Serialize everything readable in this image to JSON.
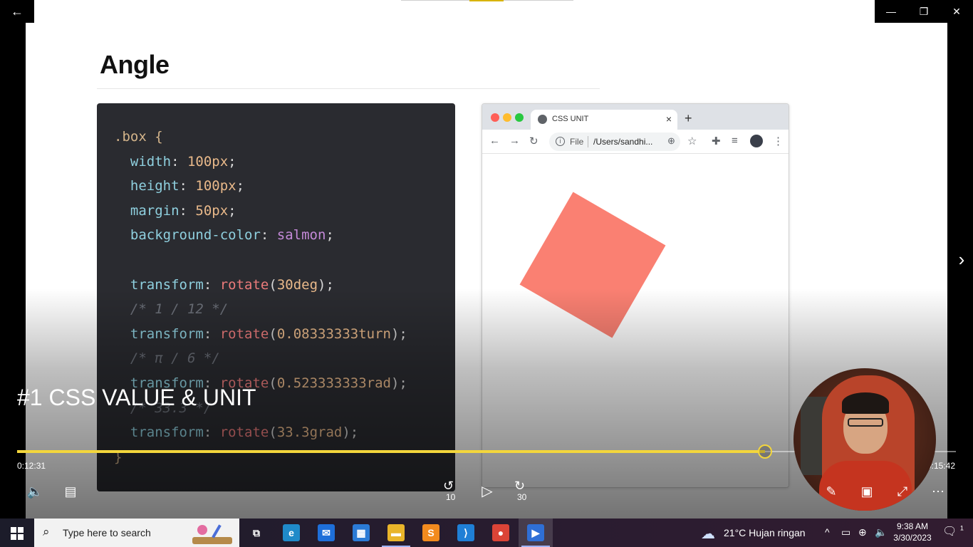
{
  "window": {
    "back_icon": "←",
    "minimize_icon": "—",
    "restore_icon": "❐",
    "close_icon": "✕",
    "next_slide_icon": "›"
  },
  "slide": {
    "title": "Angle",
    "code_lines": [
      [
        {
          "t": ".box {",
          "c": "sel"
        }
      ],
      [
        {
          "t": "  width",
          "c": "prop"
        },
        {
          "t": ": ",
          "c": "pun"
        },
        {
          "t": "100px",
          "c": "num"
        },
        {
          "t": ";",
          "c": "pun"
        }
      ],
      [
        {
          "t": "  height",
          "c": "prop"
        },
        {
          "t": ": ",
          "c": "pun"
        },
        {
          "t": "100px",
          "c": "num"
        },
        {
          "t": ";",
          "c": "pun"
        }
      ],
      [
        {
          "t": "  margin",
          "c": "prop"
        },
        {
          "t": ": ",
          "c": "pun"
        },
        {
          "t": "50px",
          "c": "num"
        },
        {
          "t": ";",
          "c": "pun"
        }
      ],
      [
        {
          "t": "  background-color",
          "c": "prop"
        },
        {
          "t": ": ",
          "c": "pun"
        },
        {
          "t": "salmon",
          "c": "kw"
        },
        {
          "t": ";",
          "c": "pun"
        }
      ],
      [
        {
          "t": "",
          "c": "pun"
        }
      ],
      [
        {
          "t": "  transform",
          "c": "prop"
        },
        {
          "t": ": ",
          "c": "pun"
        },
        {
          "t": "rotate",
          "c": "fn"
        },
        {
          "t": "(",
          "c": "pun"
        },
        {
          "t": "30deg",
          "c": "num"
        },
        {
          "t": ");",
          "c": "pun"
        }
      ],
      [
        {
          "t": "  /* 1 / 12 */",
          "c": "cm"
        }
      ],
      [
        {
          "t": "  transform",
          "c": "prop"
        },
        {
          "t": ": ",
          "c": "pun"
        },
        {
          "t": "rotate",
          "c": "fn"
        },
        {
          "t": "(",
          "c": "pun"
        },
        {
          "t": "0.08333333turn",
          "c": "num"
        },
        {
          "t": ");",
          "c": "pun"
        }
      ],
      [
        {
          "t": "  /* π / 6 */",
          "c": "cm"
        }
      ],
      [
        {
          "t": "  transform",
          "c": "prop"
        },
        {
          "t": ": ",
          "c": "pun"
        },
        {
          "t": "rotate",
          "c": "fn"
        },
        {
          "t": "(",
          "c": "pun"
        },
        {
          "t": "0.523333333rad",
          "c": "num"
        },
        {
          "t": ");",
          "c": "pun"
        }
      ],
      [
        {
          "t": "  /* 33.3 */",
          "c": "cm"
        }
      ],
      [
        {
          "t": "  transform",
          "c": "prop"
        },
        {
          "t": ": ",
          "c": "pun"
        },
        {
          "t": "rotate",
          "c": "fn"
        },
        {
          "t": "(",
          "c": "pun"
        },
        {
          "t": "33.3grad",
          "c": "num"
        },
        {
          "t": ");",
          "c": "pun"
        }
      ],
      [
        {
          "t": "}",
          "c": "sel"
        }
      ]
    ],
    "browser": {
      "tab_title": "CSS UNIT",
      "tab_close": "×",
      "new_tab": "+",
      "url_scheme": "File",
      "url": "/Users/sandhi...",
      "info_icon": "i",
      "back": "←",
      "forward": "→",
      "reload": "↻",
      "zoom_icon": "⊕",
      "star_icon": "☆",
      "extensions_icon": "✚",
      "queue_icon": "≡",
      "menu_icon": "⋮",
      "box_color": "#fa8072",
      "box_rotation_deg": 30
    }
  },
  "player": {
    "title": "#1 CSS VALUE & UNIT",
    "elapsed": "0:12:31",
    "duration": "0:15:42",
    "progress": 0.797,
    "volume_icon": "🔈",
    "captions_icon": "▤",
    "rewind_label": "10",
    "play_icon": "▷",
    "forward_label": "30",
    "pen_icon": "✎",
    "miniview_icon": "▣",
    "fullscreen_icon": "⤢",
    "more_icon": "⋯",
    "accent": "#f3d63c"
  },
  "taskbar": {
    "search_placeholder": "Type here to search",
    "search_icon": "⌕",
    "apps": [
      {
        "name": "task-view",
        "glyph": "⧉",
        "color": "transparent"
      },
      {
        "name": "edge",
        "glyph": "e",
        "color": "#1f8ac9"
      },
      {
        "name": "mail",
        "glyph": "✉",
        "color": "#1e6fd9"
      },
      {
        "name": "store",
        "glyph": "▦",
        "color": "#2b7bd6"
      },
      {
        "name": "file-explorer",
        "glyph": "▬",
        "color": "#e9b52a"
      },
      {
        "name": "sublime-text",
        "glyph": "S",
        "color": "#f28b1e"
      },
      {
        "name": "vscode",
        "glyph": "⟩",
        "color": "#1f7fd6"
      },
      {
        "name": "chrome",
        "glyph": "●",
        "color": "#db4437"
      },
      {
        "name": "movies-tv",
        "glyph": "▶",
        "color": "#2f6fd6"
      }
    ],
    "weather_icon": "☁",
    "weather": "21°C  Hujan ringan",
    "tray_chevron": "^",
    "battery_icon": "▭",
    "network_icon": "⊕",
    "volume_icon": "🔈",
    "time": "9:38 AM",
    "date": "3/30/2023",
    "notification_icon": "🗨",
    "notification_count": "1"
  }
}
